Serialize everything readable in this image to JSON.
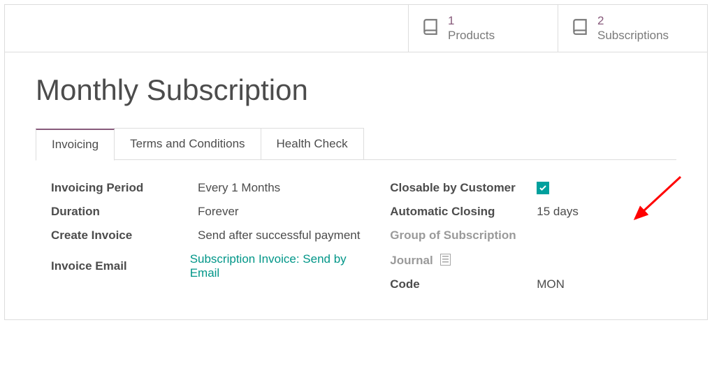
{
  "stats": {
    "products": {
      "count": "1",
      "label": "Products"
    },
    "subscriptions": {
      "count": "2",
      "label": "Subscriptions"
    }
  },
  "title": "Monthly Subscription",
  "tabs": {
    "invoicing": "Invoicing",
    "terms": "Terms and Conditions",
    "health": "Health Check"
  },
  "left": {
    "invoicing_period_label": "Invoicing Period",
    "invoicing_period_value_prefix": "Every",
    "invoicing_period_value_number": "1",
    "invoicing_period_value_unit": "Months",
    "duration_label": "Duration",
    "duration_value": "Forever",
    "create_invoice_label": "Create Invoice",
    "create_invoice_value": "Send after successful payment",
    "invoice_email_label": "Invoice Email",
    "invoice_email_value": "Subscription Invoice: Send by Email"
  },
  "right": {
    "closable_label": "Closable by Customer",
    "auto_closing_label": "Automatic Closing",
    "auto_closing_number": "15",
    "auto_closing_unit": "days",
    "group_label": "Group of Subscription",
    "journal_label": "Journal",
    "code_label": "Code",
    "code_value": "MON"
  }
}
